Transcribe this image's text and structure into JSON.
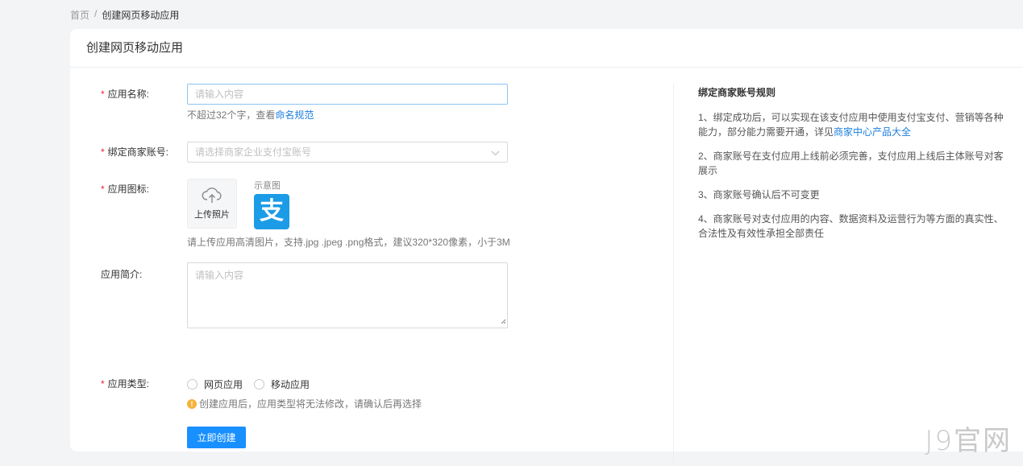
{
  "breadcrumb": {
    "home": "首页",
    "separator": "/",
    "current": "创建网页移动应用"
  },
  "card": {
    "title": "创建网页移动应用"
  },
  "form": {
    "app_name": {
      "label": "应用名称:",
      "placeholder": "请输入内容",
      "hint_prefix": "不超过32个字，查看",
      "hint_link": "命名规范"
    },
    "merchant": {
      "label": "绑定商家账号:",
      "placeholder": "请选择商家企业支付宝账号"
    },
    "icon": {
      "label": "应用图标:",
      "upload_label": "上传照片",
      "preview_label": "示意图",
      "logo_char": "支",
      "hint": "请上传应用高清图片，支持.jpg .jpeg .png格式，建议320*320像素，小于3M"
    },
    "intro": {
      "label": "应用简介:",
      "placeholder": "请输入内容"
    },
    "type": {
      "label": "应用类型:",
      "options": [
        "网页应用",
        "移动应用"
      ],
      "warning": "创建应用后，应用类型将无法修改，请确认后再选择"
    },
    "submit_label": "立即创建"
  },
  "rules": {
    "title": "绑定商家账号规则",
    "items": [
      {
        "text": "1、绑定成功后，可以实现在该支付应用中使用支付宝支付、营销等各种能力，部分能力需要开通，详见",
        "link": "商家中心产品大全"
      },
      {
        "text": "2、商家账号在支付应用上线前必须完善，支付应用上线后主体账号对客展示",
        "link": ""
      },
      {
        "text": "3、商家账号确认后不可变更",
        "link": ""
      },
      {
        "text": "4、商家账号对支付应用的内容、数据资料及运营行为等方面的真实性、合法性及有效性承担全部责任",
        "link": ""
      }
    ]
  },
  "watermark": "J9官网",
  "colors": {
    "primary": "#1890ff",
    "required": "#f5222d",
    "link": "#1a7ee0",
    "alipay": "#1c9ce6",
    "warning": "#f5b33a"
  }
}
